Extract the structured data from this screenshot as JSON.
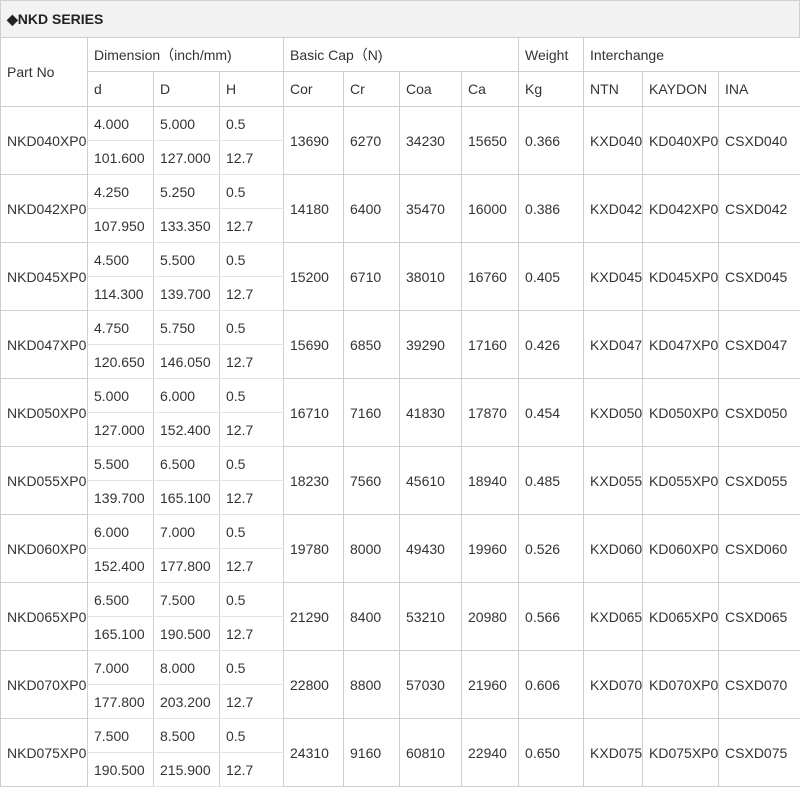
{
  "title": "◆NKD SERIES",
  "headers": {
    "part_no": "Part No",
    "dimension": "Dimension（inch/mm)",
    "basic_cap": "Basic Cap（N)",
    "weight": "Weight",
    "interchange": "Interchange",
    "d": "d",
    "D": "D",
    "H": "H",
    "cor": "Cor",
    "cr": "Cr",
    "coa": "Coa",
    "ca": "Ca",
    "kg": "Kg",
    "ntn": "NTN",
    "kaydon": "KAYDON",
    "ina": "INA"
  },
  "rows": [
    {
      "part": "NKD040XP0",
      "d_in": "4.000",
      "D_in": "5.000",
      "H_in": "0.5",
      "d_mm": "101.600",
      "D_mm": "127.000",
      "H_mm": "12.7",
      "cor": "13690",
      "cr": "6270",
      "coa": "34230",
      "ca": "15650",
      "kg": "0.366",
      "ntn": "KXD040",
      "kaydon": "KD040XP0",
      "ina": "CSXD040"
    },
    {
      "part": "NKD042XP0",
      "d_in": "4.250",
      "D_in": "5.250",
      "H_in": "0.5",
      "d_mm": "107.950",
      "D_mm": "133.350",
      "H_mm": "12.7",
      "cor": "14180",
      "cr": "6400",
      "coa": "35470",
      "ca": "16000",
      "kg": "0.386",
      "ntn": "KXD042",
      "kaydon": "KD042XP0",
      "ina": "CSXD042"
    },
    {
      "part": "NKD045XP0",
      "d_in": "4.500",
      "D_in": "5.500",
      "H_in": "0.5",
      "d_mm": "114.300",
      "D_mm": "139.700",
      "H_mm": "12.7",
      "cor": "15200",
      "cr": "6710",
      "coa": "38010",
      "ca": "16760",
      "kg": "0.405",
      "ntn": "KXD045",
      "kaydon": "KD045XP0",
      "ina": "CSXD045"
    },
    {
      "part": "NKD047XP0",
      "d_in": "4.750",
      "D_in": "5.750",
      "H_in": "0.5",
      "d_mm": "120.650",
      "D_mm": "146.050",
      "H_mm": "12.7",
      "cor": "15690",
      "cr": "6850",
      "coa": "39290",
      "ca": "17160",
      "kg": "0.426",
      "ntn": "KXD047",
      "kaydon": "KD047XP0",
      "ina": "CSXD047"
    },
    {
      "part": "NKD050XP0",
      "d_in": "5.000",
      "D_in": "6.000",
      "H_in": "0.5",
      "d_mm": "127.000",
      "D_mm": "152.400",
      "H_mm": "12.7",
      "cor": "16710",
      "cr": "7160",
      "coa": "41830",
      "ca": "17870",
      "kg": "0.454",
      "ntn": "KXD050",
      "kaydon": "KD050XP0",
      "ina": "CSXD050"
    },
    {
      "part": "NKD055XP0",
      "d_in": "5.500",
      "D_in": "6.500",
      "H_in": "0.5",
      "d_mm": "139.700",
      "D_mm": "165.100",
      "H_mm": "12.7",
      "cor": "18230",
      "cr": "7560",
      "coa": "45610",
      "ca": "18940",
      "kg": "0.485",
      "ntn": "KXD055",
      "kaydon": "KD055XP0",
      "ina": "CSXD055"
    },
    {
      "part": "NKD060XP0",
      "d_in": "6.000",
      "D_in": "7.000",
      "H_in": "0.5",
      "d_mm": "152.400",
      "D_mm": "177.800",
      "H_mm": "12.7",
      "cor": "19780",
      "cr": "8000",
      "coa": "49430",
      "ca": "19960",
      "kg": "0.526",
      "ntn": "KXD060",
      "kaydon": "KD060XP0",
      "ina": "CSXD060"
    },
    {
      "part": "NKD065XP0",
      "d_in": "6.500",
      "D_in": "7.500",
      "H_in": "0.5",
      "d_mm": "165.100",
      "D_mm": "190.500",
      "H_mm": "12.7",
      "cor": "21290",
      "cr": "8400",
      "coa": "53210",
      "ca": "20980",
      "kg": "0.566",
      "ntn": "KXD065",
      "kaydon": "KD065XP0",
      "ina": "CSXD065"
    },
    {
      "part": "NKD070XP0",
      "d_in": "7.000",
      "D_in": "8.000",
      "H_in": "0.5",
      "d_mm": "177.800",
      "D_mm": "203.200",
      "H_mm": "12.7",
      "cor": "22800",
      "cr": "8800",
      "coa": "57030",
      "ca": "21960",
      "kg": "0.606",
      "ntn": "KXD070",
      "kaydon": "KD070XP0",
      "ina": "CSXD070"
    },
    {
      "part": "NKD075XP0",
      "d_in": "7.500",
      "D_in": "8.500",
      "H_in": "0.5",
      "d_mm": "190.500",
      "D_mm": "215.900",
      "H_mm": "12.7",
      "cor": "24310",
      "cr": "9160",
      "coa": "60810",
      "ca": "22940",
      "kg": "0.650",
      "ntn": "KXD075",
      "kaydon": "KD075XP0",
      "ina": "CSXD075"
    }
  ]
}
